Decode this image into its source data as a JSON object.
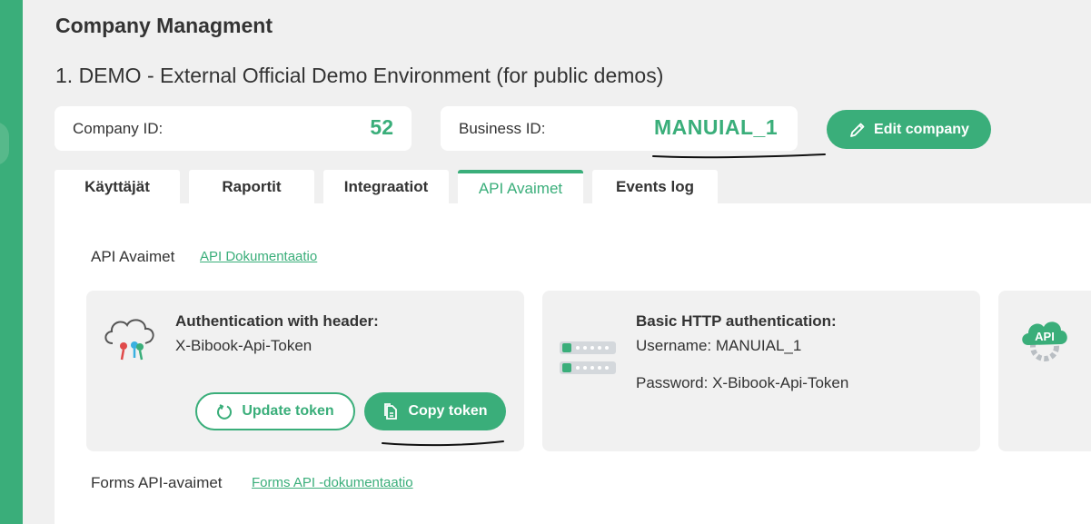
{
  "header": {
    "title": "Company Managment",
    "company_name": "1. DEMO - External Official Demo Environment (for public demos)"
  },
  "company_card": {
    "label": "Company ID:",
    "value": "52"
  },
  "business_card": {
    "label": "Business ID:",
    "value": "MANUIAL_1"
  },
  "edit_button": {
    "label": "Edit company",
    "icon": "pencil-icon"
  },
  "tabs": [
    {
      "label": "Käyttäjät"
    },
    {
      "label": "Raportit"
    },
    {
      "label": "Integraatiot"
    },
    {
      "label": "API Avaimet",
      "active": true
    },
    {
      "label": "Events log"
    }
  ],
  "api_section": {
    "label": "API Avaimet",
    "doc_link": "API Dokumentaatio"
  },
  "header_auth": {
    "title": "Authentication with header:",
    "header_name": "X-Bibook-Api-Token",
    "update_label": "Update token",
    "copy_label": "Copy token"
  },
  "basic_auth": {
    "title": "Basic HTTP authentication:",
    "username": "Username: MANUIAL_1",
    "password": "Password: X-Bibook-Api-Token"
  },
  "cloud_api_icon_label": "API",
  "forms_section": {
    "label": "Forms API-avaimet",
    "doc_link": "Forms API -dokumentaatio"
  },
  "colors": {
    "accent": "#3aae7a",
    "page_bg": "#f0f0f0",
    "card_bg": "#f1f1f1"
  }
}
